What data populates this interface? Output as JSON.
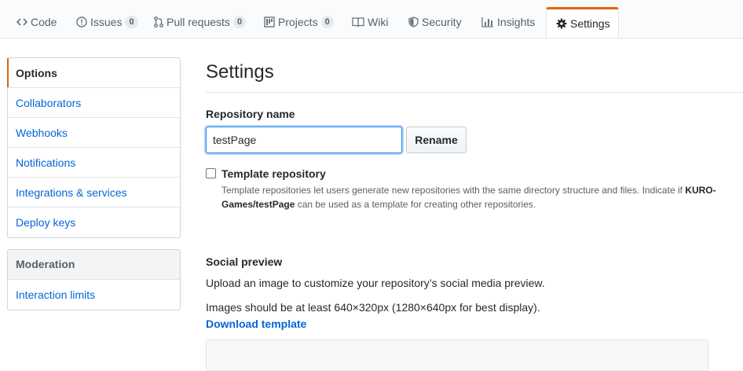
{
  "tabs": {
    "code": {
      "label": "Code",
      "icon": "code-icon"
    },
    "issues": {
      "label": "Issues",
      "count": "0",
      "icon": "issue-icon"
    },
    "pulls": {
      "label": "Pull requests",
      "count": "0",
      "icon": "pull-request-icon"
    },
    "projects": {
      "label": "Projects",
      "count": "0",
      "icon": "project-icon"
    },
    "wiki": {
      "label": "Wiki",
      "icon": "book-icon"
    },
    "security": {
      "label": "Security",
      "icon": "shield-icon"
    },
    "insights": {
      "label": "Insights",
      "icon": "graph-icon"
    },
    "settings": {
      "label": "Settings",
      "icon": "gear-icon",
      "selected": true
    }
  },
  "sidebar": {
    "items": [
      {
        "label": "Options",
        "selected": true
      },
      {
        "label": "Collaborators"
      },
      {
        "label": "Webhooks"
      },
      {
        "label": "Notifications"
      },
      {
        "label": "Integrations & services"
      },
      {
        "label": "Deploy keys"
      }
    ],
    "moderation": {
      "heading": "Moderation",
      "items": [
        {
          "label": "Interaction limits"
        }
      ]
    }
  },
  "main": {
    "title": "Settings",
    "repo_name_label": "Repository name",
    "repo_name_value": "testPage",
    "rename_label": "Rename",
    "template_label": "Template repository",
    "template_note_start": "Template repositories let users generate new repositories with the same directory structure and files. Indicate if ",
    "template_note_repo": "KURO-Games/testPage",
    "template_note_end": " can be used as a template for creating other repositories.",
    "social_heading": "Social preview",
    "social_desc": "Upload an image to customize your repository’s social media preview.",
    "social_size": "Images should be at least 640×320px (1280×640px for best display).",
    "download_label": "Download template"
  },
  "colors": {
    "accent": "#e36209",
    "link": "#0366d6",
    "text": "#24292e",
    "muted": "#586069"
  }
}
